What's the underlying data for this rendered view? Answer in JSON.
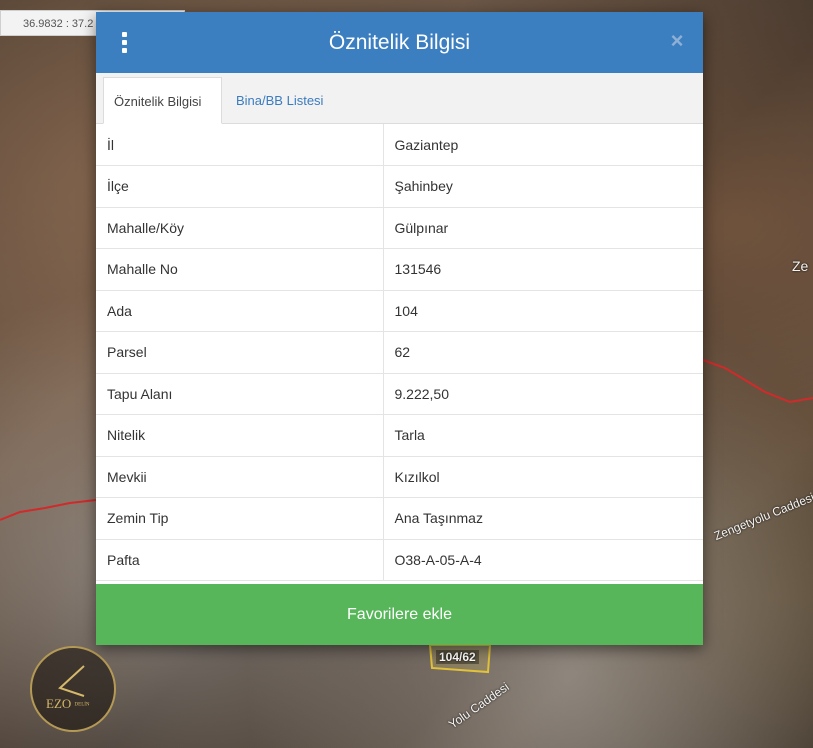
{
  "map": {
    "coordinate_readout": "36.9832 : 37.2",
    "labels": {
      "street_right": "Zengetyolu Caddesi",
      "street_bottom": "Yolu Caddesi",
      "edge_text": "Ze",
      "parcel": "104/62"
    },
    "logo": {
      "text": "EZO",
      "subtext": "DELİN"
    }
  },
  "dialog": {
    "title": "Öznitelik Bilgisi",
    "menu_icon": "vertical-dots-icon",
    "close_icon": "close-icon",
    "tabs": [
      {
        "label": "Öznitelik Bilgisi",
        "active": true
      },
      {
        "label": "Bina/BB Listesi",
        "active": false
      }
    ],
    "rows": [
      {
        "key": "İl",
        "value": "Gaziantep"
      },
      {
        "key": "İlçe",
        "value": "Şahinbey"
      },
      {
        "key": "Mahalle/Köy",
        "value": "Gülpınar"
      },
      {
        "key": "Mahalle No",
        "value": "131546"
      },
      {
        "key": "Ada",
        "value": "104"
      },
      {
        "key": "Parsel",
        "value": "62"
      },
      {
        "key": "Tapu Alanı",
        "value": "9.222,50"
      },
      {
        "key": "Nitelik",
        "value": "Tarla"
      },
      {
        "key": "Mevkii",
        "value": "Kızılkol"
      },
      {
        "key": "Zemin Tip",
        "value": "Ana Taşınmaz"
      },
      {
        "key": "Pafta",
        "value": "O38-A-05-A-4"
      }
    ],
    "favorite_button": "Favorilere ekle"
  },
  "colors": {
    "header": "#3c7fc1",
    "favorite_button": "#58b65a",
    "tab_link": "#3a7cc0",
    "boundary": "#d12a2a"
  }
}
